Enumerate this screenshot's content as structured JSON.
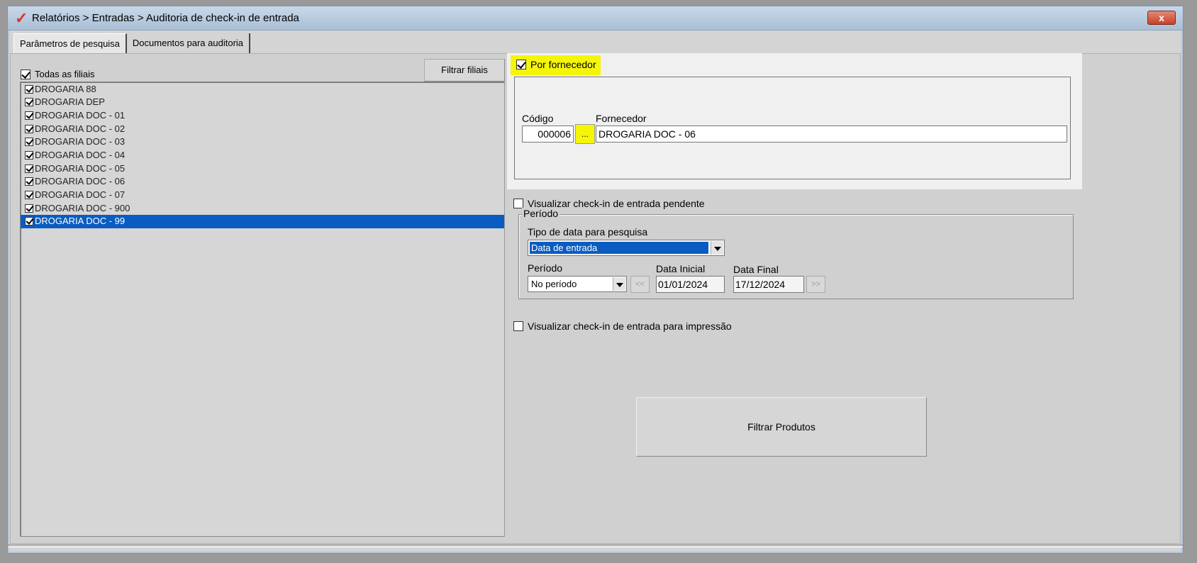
{
  "window": {
    "title": "Relatórios > Entradas > Auditoria de check-in de entrada",
    "logo_icon": "check-logo-icon",
    "close_glyph": "x"
  },
  "tabs": [
    {
      "label": "Parâmetros de pesquisa",
      "active": true
    },
    {
      "label": "Documentos para auditoria",
      "active": false
    }
  ],
  "branches": {
    "all_label": "Todas as filiais",
    "all_checked": true,
    "filter_button": "Filtrar filiais",
    "items": [
      {
        "label": "DROGARIA 88",
        "checked": true
      },
      {
        "label": "DROGARIA DEP",
        "checked": true
      },
      {
        "label": "DROGARIA DOC - 01",
        "checked": true
      },
      {
        "label": "DROGARIA DOC - 02",
        "checked": true
      },
      {
        "label": "DROGARIA DOC - 03",
        "checked": true
      },
      {
        "label": "DROGARIA DOC - 04",
        "checked": true
      },
      {
        "label": "DROGARIA DOC - 05",
        "checked": true
      },
      {
        "label": "DROGARIA DOC - 06",
        "checked": true
      },
      {
        "label": "DROGARIA DOC - 07",
        "checked": true
      },
      {
        "label": "DROGARIA DOC - 900",
        "checked": true
      },
      {
        "label": "DROGARIA DOC - 99",
        "checked": true,
        "selected": true
      }
    ]
  },
  "supplier": {
    "checkbox_label": "Por fornecedor",
    "checked": true,
    "codigo_label": "Código",
    "codigo_value": "000006",
    "lookup_button": "...",
    "fornecedor_label": "Fornecedor",
    "fornecedor_value": "DROGARIA DOC - 06",
    "highlight_color": "#f5f50a"
  },
  "pendente": {
    "label": "Visualizar check-in de entrada pendente",
    "checked": false
  },
  "periodo": {
    "legend": "Período",
    "tipo_data_label": "Tipo de data para pesquisa",
    "tipo_data_value": "Data de entrada",
    "periodo_label": "Período",
    "periodo_value": "No período",
    "prev_button": "<<",
    "next_button": ">>",
    "data_inicial_label": "Data Inicial",
    "data_inicial_value": "01/01/2024",
    "data_final_label": "Data Final",
    "data_final_value": "17/12/2024"
  },
  "impressao": {
    "label": "Visualizar check-in de entrada para impressão",
    "checked": false
  },
  "filtrar_produtos_button": "Filtrar Produtos",
  "colors": {
    "selection": "#0a5cc0",
    "close": "#c7412a"
  }
}
